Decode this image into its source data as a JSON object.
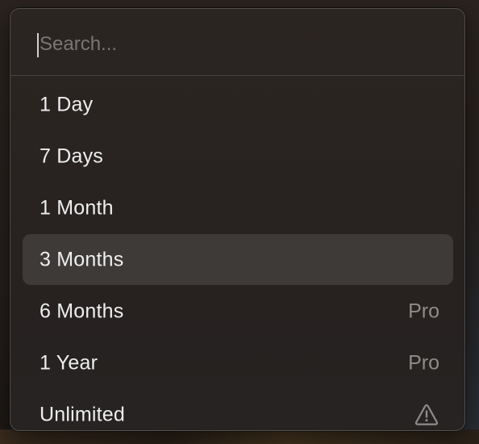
{
  "search": {
    "placeholder": "Search...",
    "value": ""
  },
  "items": [
    {
      "label": "1 Day",
      "accessory": "",
      "selected": false
    },
    {
      "label": "7 Days",
      "accessory": "",
      "selected": false
    },
    {
      "label": "1 Month",
      "accessory": "",
      "selected": false
    },
    {
      "label": "3 Months",
      "accessory": "",
      "selected": true
    },
    {
      "label": "6 Months",
      "accessory": "Pro",
      "selected": false
    },
    {
      "label": "1 Year",
      "accessory": "Pro",
      "selected": false
    },
    {
      "label": "Unlimited",
      "accessory_icon": "warning-icon",
      "selected": false
    }
  ],
  "colors": {
    "menu_background": "#272220",
    "selected_background": "rgba(255,255,255,0.11)",
    "text": "#eeeeef",
    "accessory_text": "#8e8b89",
    "placeholder": "#7b7674",
    "caret": "#cfd2d6"
  }
}
